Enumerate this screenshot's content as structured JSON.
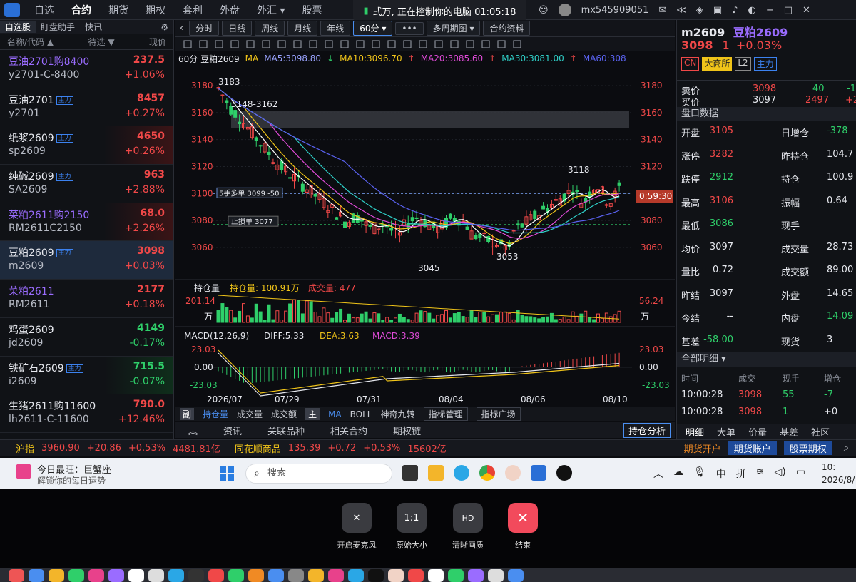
{
  "top_menu": [
    "自选",
    "合约",
    "期货",
    "期权",
    "套利",
    "外盘",
    "外汇 ▾",
    "股票"
  ],
  "top_menu_active": 1,
  "remote_banner": "弍万, 正在控制你的电脑 01:05:18",
  "account_id": "mx545909051",
  "watchlist": {
    "tabs": [
      "自选股",
      "盯盘助手",
      "快讯"
    ],
    "col_name": "名称/代码 ▲",
    "col_filter": "待选 ▼",
    "col_price": "现价",
    "rows": [
      {
        "name": "豆油2701购8400",
        "code": "y2701-C-8400",
        "price": "237.5",
        "pct": "+1.06%",
        "dir": "up",
        "tag": ""
      },
      {
        "name": "豆油2701",
        "code": "y2701",
        "price": "8457",
        "pct": "+0.27%",
        "dir": "up",
        "tag": "主力"
      },
      {
        "name": "纸浆2609",
        "code": "sp2609",
        "price": "4650",
        "pct": "+0.26%",
        "dir": "up",
        "tag": "主力"
      },
      {
        "name": "纯碱2609",
        "code": "SA2609",
        "price": "963",
        "pct": "+2.88%",
        "dir": "up",
        "tag": "主力"
      },
      {
        "name": "菜粕2611购2150",
        "code": "RM2611C2150",
        "price": "68.0",
        "pct": "+2.26%",
        "dir": "up",
        "tag": ""
      },
      {
        "name": "豆粕2609",
        "code": "m2609",
        "price": "3098",
        "pct": "+0.03%",
        "dir": "up",
        "tag": "主力"
      },
      {
        "name": "菜粕2611",
        "code": "RM2611",
        "price": "2177",
        "pct": "+0.18%",
        "dir": "up",
        "tag": ""
      },
      {
        "name": "鸡蛋2609",
        "code": "jd2609",
        "price": "4149",
        "pct": "-0.17%",
        "dir": "dn",
        "tag": ""
      },
      {
        "name": "铁矿石2609",
        "code": "i2609",
        "price": "715.5",
        "pct": "-0.07%",
        "dir": "dn",
        "tag": "主力"
      },
      {
        "name": "生猪2611购11600",
        "code": "lh2611-C-11600",
        "price": "790.0",
        "pct": "+12.46%",
        "dir": "up",
        "tag": ""
      }
    ]
  },
  "chart_toolbar": [
    "分时",
    "日线",
    "周线",
    "月线",
    "年线",
    "60分 ▾",
    "•••",
    "多周期图 ▾",
    "合约资料"
  ],
  "chart_toolbar_active": 5,
  "ma_legend": {
    "title": "60分 豆粕2609",
    "ma5": "MA5:3098.80",
    "ma10": "MA10:3096.70",
    "ma20": "MA20:3085.60",
    "ma30": "MA30:3081.00",
    "ma60": "MA60:308",
    "colors": {
      "ma5": "#ffffff",
      "ma10": "#f0c419",
      "ma20": "#e04bd8",
      "ma30": "#2fd0c8",
      "ma60": "#5a62f0"
    }
  },
  "price_axis": [
    "3180",
    "3160",
    "3140",
    "3120",
    "3100",
    "3080",
    "3060"
  ],
  "annotations": {
    "hi1": "3183",
    "hi2": "3148-3162",
    "hi3": "3118",
    "lo1": "3045",
    "lo2": "3053",
    "order": "5手多单 3099 -50",
    "stop": "止损单 3077",
    "countdown": "0:59:30"
  },
  "volume_panel": {
    "title": "持仓量",
    "oi": "持仓量: 100.91万",
    "vol": "成交量: 477",
    "left_top": "201.14",
    "left_unit": "万",
    "right_top": "56.24",
    "right_unit": "万"
  },
  "macd_panel": {
    "title": "MACD(12,26,9)",
    "diff": "DIFF:5.33",
    "dea": "DEA:3.63",
    "macd": "MACD:3.39",
    "left_top": "23.03",
    "left_mid": "0.00",
    "left_bot": "-23.03",
    "right_top": "23.03",
    "right_mid": "0.00",
    "right_bot": "-23.03"
  },
  "date_axis": [
    "2026/07",
    "07/29",
    "07/31",
    "08/04",
    "08/06",
    "08/10"
  ],
  "indicator_tabs": [
    "副",
    "持仓量",
    "成交量",
    "成交额",
    "主",
    "MA",
    "BOLL",
    "神奇九转",
    "指标管理",
    "指标广场"
  ],
  "info_tabs": [
    "资讯",
    "关联品种",
    "相关合约",
    "期权链"
  ],
  "info_button": "持仓分析",
  "quote": {
    "code": "m2609",
    "name": "豆粕2609",
    "price": "3098",
    "chg": "1",
    "pct": "+0.03%",
    "badges": [
      "CN",
      "大商所",
      "L2",
      "主力"
    ],
    "ask_label": "卖价",
    "ask": "3098",
    "ask_vol": "40",
    "ask_x": "-1",
    "bid_label": "买价",
    "bid": "3097",
    "bid_vol": "2497",
    "bid_x": "+2",
    "panel_title": "盘口数据",
    "fields": [
      [
        "开盘",
        "3105",
        "日增仓",
        "-378"
      ],
      [
        "涨停",
        "3282",
        "昨持仓",
        "104.7"
      ],
      [
        "跌停",
        "2912",
        "持仓",
        "100.9"
      ],
      [
        "最高",
        "3106",
        "振幅",
        "0.64"
      ],
      [
        "最低",
        "3086",
        "现手",
        ""
      ],
      [
        "均价",
        "3097",
        "成交量",
        "28.73"
      ],
      [
        "量比",
        "0.72",
        "成交额",
        "89.00"
      ],
      [
        "昨结",
        "3097",
        "外盘",
        "14.65"
      ],
      [
        "今结",
        "--",
        "内盘",
        "14.09"
      ],
      [
        "基差",
        "-58.00",
        "现货",
        "3"
      ]
    ],
    "trades_title": "全部明细 ▾",
    "trades_cols": [
      "时间",
      "成交",
      "现手",
      "增仓"
    ],
    "trades": [
      [
        "10:00:28",
        "3098",
        "55",
        "-7"
      ],
      [
        "10:00:28",
        "3098",
        "1",
        "+0"
      ]
    ],
    "right_tabs": [
      "明细",
      "大单",
      "价量",
      "基差",
      "社区"
    ]
  },
  "status": {
    "idx_name": "沪指",
    "idx_val": "3960.90",
    "idx_chg": "+20.86",
    "idx_pct": "+0.53%",
    "idx_amt": "4481.81亿",
    "c_name": "同花顺商品",
    "c_val": "135.39",
    "c_chg": "+0.72",
    "c_pct": "+0.53%",
    "c_amt": "15602亿",
    "open": "期货开户",
    "acct": "期货账户",
    "opt": "股票期权"
  },
  "taskbar": {
    "news_title": "今日最旺：巨蟹座",
    "news_sub": "解锁你的每日运势",
    "search": "搜索",
    "ime1": "中",
    "ime2": "拼",
    "clock": "10:",
    "date": "2026/8/"
  },
  "remote_controls": [
    {
      "label": "开启麦克风",
      "icon": "mic-off-icon"
    },
    {
      "label": "原始大小",
      "icon": "ratio-icon"
    },
    {
      "label": "清晰画质",
      "icon": "hd-icon"
    },
    {
      "label": "结束",
      "icon": "close-icon"
    }
  ]
}
